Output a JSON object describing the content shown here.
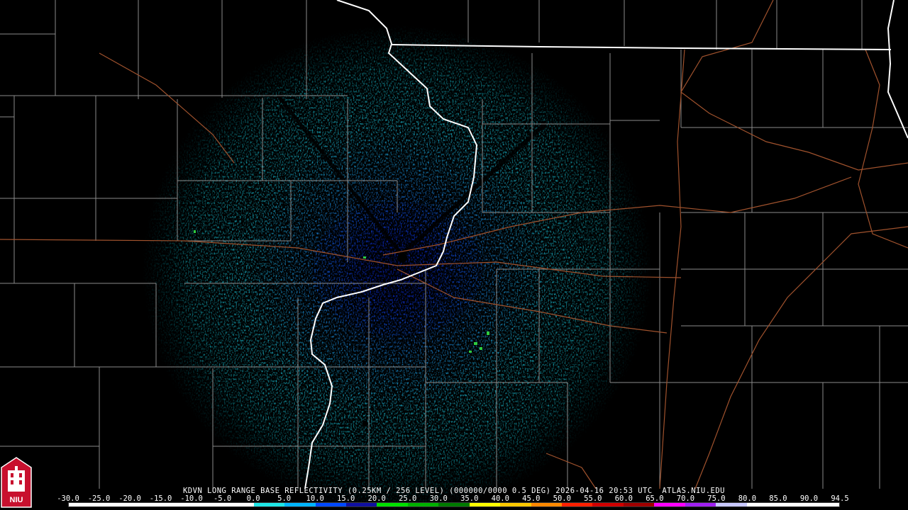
{
  "product": {
    "caption": "KDVN LONG RANGE BASE REFLECTIVITY (0.25KM / 256 LEVEL) (000000/0000 0.5 DEG) 2026-04-16 20:53 UTC  ATLAS.NIU.EDU"
  },
  "legend": {
    "values": [
      "-30.0",
      "-25.0",
      "-20.0",
      "-15.0",
      "-10.0",
      "-5.0",
      "0.0",
      "5.0",
      "10.0",
      "15.0",
      "20.0",
      "25.0",
      "30.0",
      "35.0",
      "40.0",
      "45.0",
      "50.0",
      "55.0",
      "60.0",
      "65.0",
      "70.0",
      "75.0",
      "80.0",
      "85.0",
      "90.0",
      "94.5"
    ],
    "colors": [
      "#ffffff",
      "#ffffff",
      "#ffffff",
      "#ffffff",
      "#ffffff",
      "#ffffff",
      "#1fe6e6",
      "#00b4ff",
      "#0048ff",
      "#1010a0",
      "#00e000",
      "#00b000",
      "#007a00",
      "#ffff00",
      "#ffc800",
      "#ff8800",
      "#ff2000",
      "#d00000",
      "#a00000",
      "#ff00ff",
      "#a020f0",
      "#c8c8ff",
      "#ffffff",
      "#ffffff",
      "#ffffff"
    ]
  },
  "logo": {
    "text": "NIU"
  },
  "map_features": {
    "radar_site": "KDVN",
    "boundary_colors": {
      "county": "#8a8a8a",
      "state": "#ffffff",
      "road": "#a0522d"
    }
  }
}
